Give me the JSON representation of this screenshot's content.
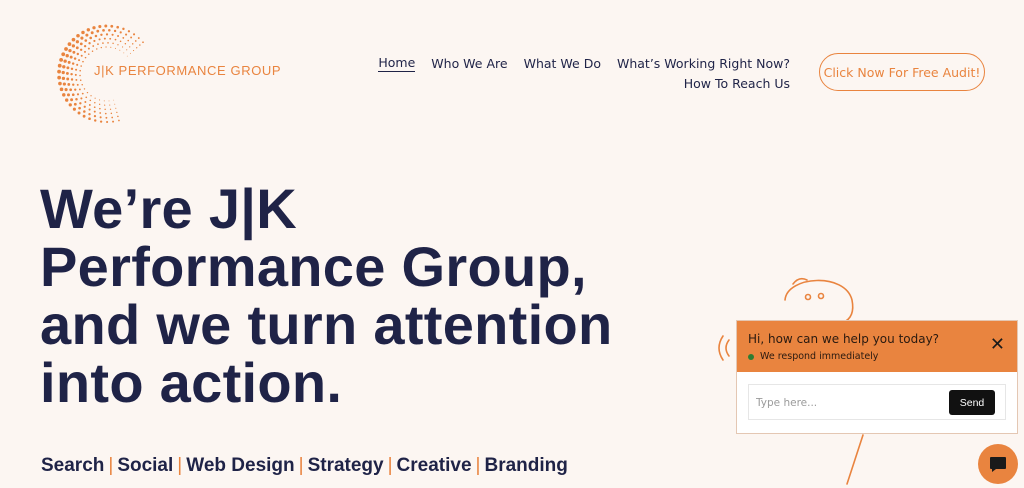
{
  "brand": {
    "name": "J|K PERFORMANCE GROUP",
    "accent": "#e9843f",
    "text_color": "#1f2347",
    "background": "#fcf6f2"
  },
  "nav": {
    "items": [
      {
        "label": "Home",
        "active": true
      },
      {
        "label": "Who We Are"
      },
      {
        "label": "What We Do"
      },
      {
        "label": "What’s Working Right Now?"
      },
      {
        "label": "How To Reach Us"
      }
    ],
    "cta_label": "Click Now For Free Audit!"
  },
  "hero": {
    "lines": [
      "We’re J|K",
      "Performance Group,",
      "and we turn attention",
      "into action."
    ]
  },
  "services": {
    "items": [
      "Search",
      "Social",
      "Web Design",
      "Strategy",
      "Creative",
      "Branding"
    ],
    "separator": "|"
  },
  "chat": {
    "title": "Hi, how can we help you today?",
    "status": "We respond immediately",
    "placeholder": "Type here...",
    "send_label": "Send",
    "close_icon": "close-icon",
    "launcher_icon": "chat-bubble-icon"
  }
}
